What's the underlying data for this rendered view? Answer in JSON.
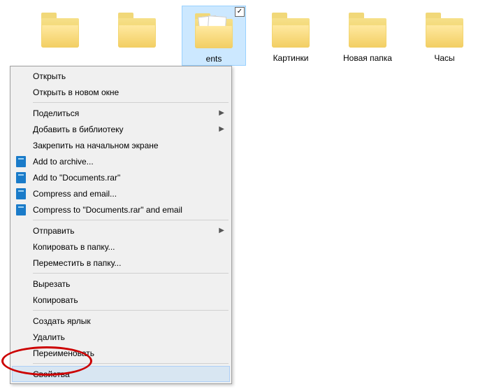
{
  "folders": [
    {
      "label": "",
      "selected": false
    },
    {
      "label": "",
      "selected": false
    },
    {
      "label": "ents",
      "selected": true,
      "hasDocs": true,
      "checked": true
    },
    {
      "label": "Картинки",
      "selected": false
    },
    {
      "label": "Новая папка",
      "selected": false
    },
    {
      "label": "Часы",
      "selected": false
    }
  ],
  "menu": {
    "open": "Открыть",
    "openNew": "Открыть в новом окне",
    "share": "Поделиться",
    "addLib": "Добавить в библиотеку",
    "pinStart": "Закрепить на начальном экране",
    "addArchive": "Add to archive...",
    "addDocsRar": "Add to \"Documents.rar\"",
    "compressEmail": "Compress and email...",
    "compressDocsEmail": "Compress to \"Documents.rar\" and email",
    "send": "Отправить",
    "copyTo": "Копировать в папку...",
    "moveTo": "Переместить в папку...",
    "cut": "Вырезать",
    "copy": "Копировать",
    "shortcut": "Создать ярлык",
    "delete": "Удалить",
    "rename": "Переименовать",
    "properties": "Свойства"
  }
}
